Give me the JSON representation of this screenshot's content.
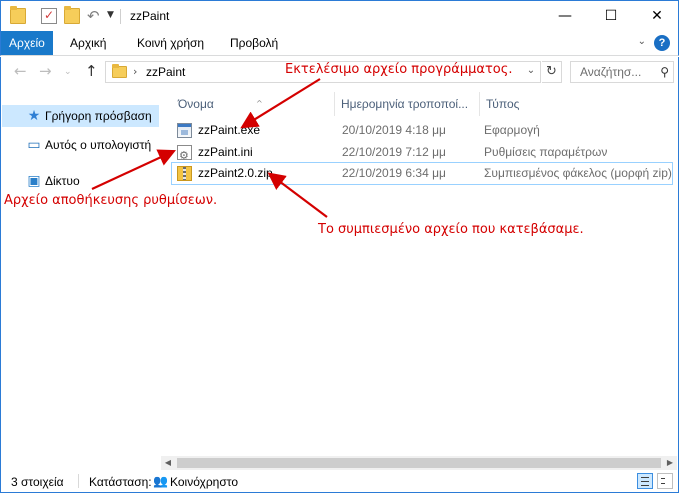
{
  "window": {
    "title": "zzPaint",
    "minimize_glyph": "—",
    "maximize_glyph": "☐",
    "close_glyph": "✕"
  },
  "ribbon": {
    "tabs": [
      {
        "label": "Αρχείο",
        "active": true
      },
      {
        "label": "Αρχική",
        "active": false
      },
      {
        "label": "Κοινή χρήση",
        "active": false
      },
      {
        "label": "Προβολή",
        "active": false
      }
    ],
    "help_glyph": "?"
  },
  "address": {
    "path": "zzPaint",
    "search_placeholder": "Αναζήτησ..."
  },
  "sidebar": {
    "items": [
      {
        "label": "Γρήγορη πρόσβαση",
        "icon": "star-icon",
        "selected": true
      },
      {
        "label": "Αυτός ο υπολογιστή",
        "icon": "computer-icon",
        "selected": false
      },
      {
        "label": "Δίκτυο",
        "icon": "network-icon",
        "selected": false
      }
    ]
  },
  "columns": {
    "name": "Όνομα",
    "date": "Ημερομηνία τροποποί...",
    "type": "Τύπος"
  },
  "files": [
    {
      "name": "zzPaint.exe",
      "date": "20/10/2019 4:18 μμ",
      "type": "Εφαρμογή",
      "icon": "exe-icon"
    },
    {
      "name": "zzPaint.ini",
      "date": "22/10/2019 7:12 μμ",
      "type": "Ρυθμίσεις παραμέτρων",
      "icon": "ini-icon"
    },
    {
      "name": "zzPaint2.0.zip",
      "date": "22/10/2019 6:34 μμ",
      "type": "Συμπιεσμένος φάκελος (μορφή zip)",
      "icon": "zip-icon"
    }
  ],
  "annotations": {
    "exe": "Εκτελέσιμο αρχείο προγράμματος.",
    "ini": "Αρχείο αποθήκευσης ρυθμίσεων.",
    "zip": "Το συμπιεσμένο αρχείο που κατεβάσαμε.",
    "color": "#d40000"
  },
  "status": {
    "count": "3 στοιχεία",
    "state_label": "Κατάσταση:",
    "state_value": "Κοινόχρηστο"
  },
  "colors": {
    "accent": "#1979ca",
    "selection": "#cce8ff",
    "window_border": "#2b7bd6"
  }
}
